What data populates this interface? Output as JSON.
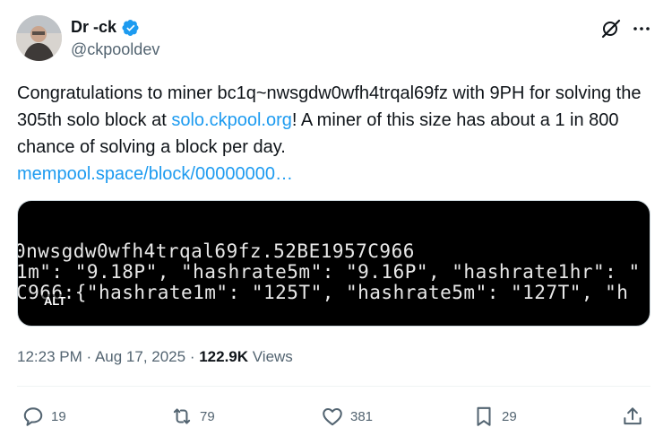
{
  "author": {
    "display_name": "Dr -ck",
    "handle": "@ckpooldev"
  },
  "tweet": {
    "text_part1": "Congratulations to miner bc1q~nwsgdw0wfh4trqal69fz with 9PH for solving the 305th solo block at ",
    "link1": "solo.ckpool.org",
    "text_part2": "! A miner of this size has about a 1 in 800 chance of solving a block per day.",
    "link2": "mempool.space/block/00000000…"
  },
  "media": {
    "line1": "0nwsgdw0wfh4trqal69fz.52BE1957C966",
    "line2": "1m\": \"9.18P\", \"hashrate5m\": \"9.16P\", \"hashrate1hr\": \"",
    "line3": "C966:{\"hashrate1m\": \"125T\", \"hashrate5m\": \"127T\", \"h",
    "alt_label": "ALT"
  },
  "meta": {
    "time": "12:23 PM",
    "sep1": " · ",
    "date": "Aug 17, 2025",
    "sep2": " · ",
    "views_count": "122.9K",
    "views_label": " Views"
  },
  "actions": {
    "replies": "19",
    "reposts": "79",
    "likes": "381",
    "bookmarks": "29"
  },
  "colors": {
    "link": "#1d9bf0",
    "verified": "#1d9bf0",
    "secondary_text": "#536471"
  }
}
